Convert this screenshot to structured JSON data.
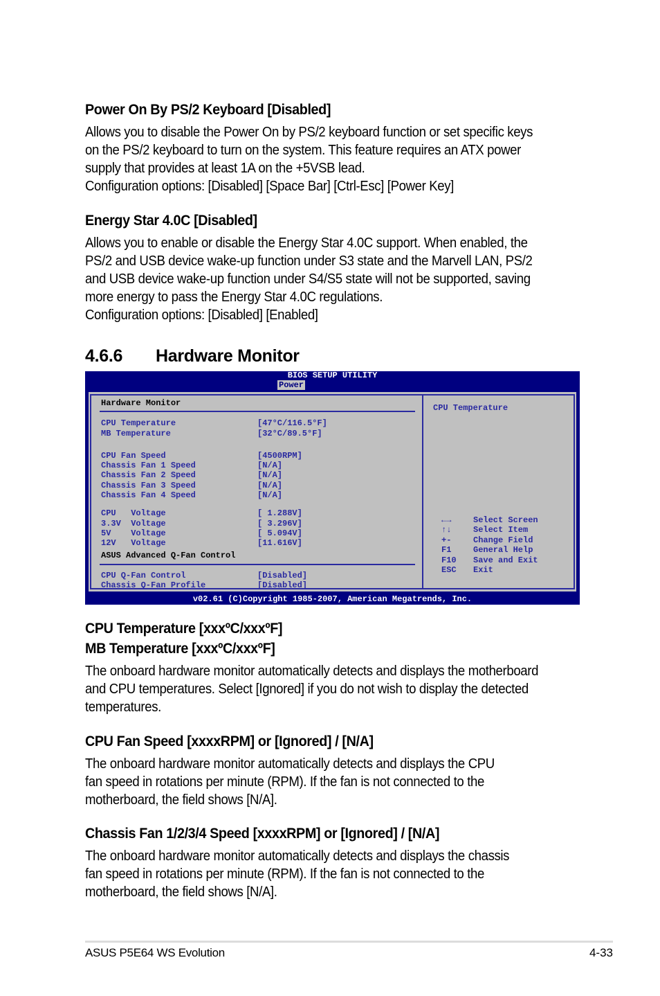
{
  "sections_top": [
    {
      "heading": "Power On By PS/2 Keyboard [Disabled]",
      "lines": [
        "Allows you to disable the Power On by PS/2 keyboard function or set specific keys",
        "on the PS/2 keyboard to turn on the system. This feature requires an ATX power",
        "supply that provides at least 1A on the +5VSB lead.",
        "Configuration options: [Disabled] [Space Bar] [Ctrl-Esc] [Power Key]"
      ]
    },
    {
      "heading": "Energy Star 4.0C [Disabled]",
      "lines": [
        "Allows you to enable or disable the Energy Star 4.0C support. When enabled, the",
        "PS/2 and USB device wake-up function under S3 state and the Marvell LAN, PS/2",
        "and USB device wake-up function under S4/S5 state will not be supported, saving",
        "more energy to pass the Energy Star 4.0C regulations.",
        "Configuration options: [Disabled] [Enabled]"
      ]
    }
  ],
  "section_title": {
    "number": "4.6.6",
    "text": "Hardware Monitor"
  },
  "bios": {
    "title": "BIOS SETUP UTILITY",
    "tab": "Power",
    "panel_title": "Hardware Monitor",
    "items": [
      {
        "label": "CPU Temperature",
        "value": "[47°C/116.5°F]"
      },
      {
        "label": "MB Temperature",
        "value": "[32°C/89.5°F]"
      },
      {
        "label": "CPU Fan Speed",
        "value": "[4500RPM]"
      },
      {
        "label": "Chassis Fan 1 Speed",
        "value": "[N/A]"
      },
      {
        "label": "Chassis Fan 2 Speed",
        "value": "[N/A]"
      },
      {
        "label": "Chassis Fan 3 Speed",
        "value": "[N/A]"
      },
      {
        "label": "Chassis Fan 4 Speed",
        "value": "[N/A]"
      },
      {
        "label": "CPU   Voltage",
        "value": "[ 1.288V]"
      },
      {
        "label": "3.3V  Voltage",
        "value": "[ 3.296V]"
      },
      {
        "label": "5V    Voltage",
        "value": "[ 5.094V]"
      },
      {
        "label": "12V   Voltage",
        "value": "[11.616V]"
      }
    ],
    "qfan_header": "ASUS Advanced Q-Fan Control",
    "qfan_items": [
      {
        "label": "CPU Q-Fan Control",
        "value": "[Disabled]"
      },
      {
        "label": "Chassis Q-Fan Profile",
        "value": "[Disabled]"
      }
    ],
    "help_title": "CPU Temperature",
    "keys": [
      {
        "key": "←→",
        "desc": "Select Screen"
      },
      {
        "key": "↑↓",
        "desc": "Select Item"
      },
      {
        "key": "+-",
        "desc": "Change Field"
      },
      {
        "key": "F1",
        "desc": "General Help"
      },
      {
        "key": "F10",
        "desc": "Save and Exit"
      },
      {
        "key": "ESC",
        "desc": "Exit"
      }
    ],
    "footer": "v02.61 (C)Copyright 1985-2007, American Megatrends, Inc."
  },
  "sections_bottom": [
    {
      "heading_lines": [
        "CPU Temperature [xxxºC/xxxºF]",
        "MB Temperature [xxxºC/xxxºF]"
      ],
      "lines": [
        "The onboard hardware monitor automatically detects and displays the motherboard",
        "and CPU temperatures. Select [Ignored] if you do not wish to display the detected",
        "temperatures."
      ]
    },
    {
      "heading_lines": [
        "CPU Fan Speed [xxxxRPM] or [Ignored] / [N/A]"
      ],
      "lines": [
        "The onboard hardware monitor automatically detects and displays the CPU",
        "fan speed in rotations per minute (RPM). If the fan is not connected to the",
        "motherboard, the field shows [N/A]."
      ]
    },
    {
      "heading_lines": [
        "Chassis Fan 1/2/3/4 Speed [xxxxRPM] or [Ignored] / [N/A]"
      ],
      "lines": [
        "The onboard hardware monitor automatically detects and displays the chassis",
        "fan speed in rotations per minute (RPM). If the fan is not connected to the",
        "motherboard, the field shows [N/A]."
      ]
    }
  ],
  "footer": {
    "product": "ASUS P5E64 WS Evolution",
    "page": "4-33"
  }
}
